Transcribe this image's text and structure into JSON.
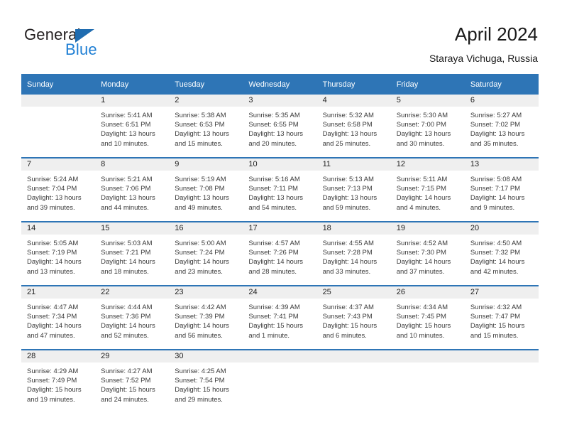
{
  "brand": {
    "name_part1": "General",
    "name_part2": "Blue",
    "triangle_color": "#1f6cb0",
    "blue_text_color": "#1f7fd4"
  },
  "header": {
    "title": "April 2024",
    "subtitle": "Staraya Vichuga, Russia"
  },
  "theme": {
    "header_blue": "#2e75b6",
    "daynum_band": "#efefef",
    "text": "#3a3a3a"
  },
  "weekday_headers": [
    "Sunday",
    "Monday",
    "Tuesday",
    "Wednesday",
    "Thursday",
    "Friday",
    "Saturday"
  ],
  "weeks": [
    [
      {
        "day": "",
        "sunrise": "",
        "sunset": "",
        "daylight_line1": "",
        "daylight_line2": "",
        "empty": true
      },
      {
        "day": "1",
        "sunrise": "Sunrise: 5:41 AM",
        "sunset": "Sunset: 6:51 PM",
        "daylight_line1": "Daylight: 13 hours",
        "daylight_line2": "and 10 minutes."
      },
      {
        "day": "2",
        "sunrise": "Sunrise: 5:38 AM",
        "sunset": "Sunset: 6:53 PM",
        "daylight_line1": "Daylight: 13 hours",
        "daylight_line2": "and 15 minutes."
      },
      {
        "day": "3",
        "sunrise": "Sunrise: 5:35 AM",
        "sunset": "Sunset: 6:55 PM",
        "daylight_line1": "Daylight: 13 hours",
        "daylight_line2": "and 20 minutes."
      },
      {
        "day": "4",
        "sunrise": "Sunrise: 5:32 AM",
        "sunset": "Sunset: 6:58 PM",
        "daylight_line1": "Daylight: 13 hours",
        "daylight_line2": "and 25 minutes."
      },
      {
        "day": "5",
        "sunrise": "Sunrise: 5:30 AM",
        "sunset": "Sunset: 7:00 PM",
        "daylight_line1": "Daylight: 13 hours",
        "daylight_line2": "and 30 minutes."
      },
      {
        "day": "6",
        "sunrise": "Sunrise: 5:27 AM",
        "sunset": "Sunset: 7:02 PM",
        "daylight_line1": "Daylight: 13 hours",
        "daylight_line2": "and 35 minutes."
      }
    ],
    [
      {
        "day": "7",
        "sunrise": "Sunrise: 5:24 AM",
        "sunset": "Sunset: 7:04 PM",
        "daylight_line1": "Daylight: 13 hours",
        "daylight_line2": "and 39 minutes."
      },
      {
        "day": "8",
        "sunrise": "Sunrise: 5:21 AM",
        "sunset": "Sunset: 7:06 PM",
        "daylight_line1": "Daylight: 13 hours",
        "daylight_line2": "and 44 minutes."
      },
      {
        "day": "9",
        "sunrise": "Sunrise: 5:19 AM",
        "sunset": "Sunset: 7:08 PM",
        "daylight_line1": "Daylight: 13 hours",
        "daylight_line2": "and 49 minutes."
      },
      {
        "day": "10",
        "sunrise": "Sunrise: 5:16 AM",
        "sunset": "Sunset: 7:11 PM",
        "daylight_line1": "Daylight: 13 hours",
        "daylight_line2": "and 54 minutes."
      },
      {
        "day": "11",
        "sunrise": "Sunrise: 5:13 AM",
        "sunset": "Sunset: 7:13 PM",
        "daylight_line1": "Daylight: 13 hours",
        "daylight_line2": "and 59 minutes."
      },
      {
        "day": "12",
        "sunrise": "Sunrise: 5:11 AM",
        "sunset": "Sunset: 7:15 PM",
        "daylight_line1": "Daylight: 14 hours",
        "daylight_line2": "and 4 minutes."
      },
      {
        "day": "13",
        "sunrise": "Sunrise: 5:08 AM",
        "sunset": "Sunset: 7:17 PM",
        "daylight_line1": "Daylight: 14 hours",
        "daylight_line2": "and 9 minutes."
      }
    ],
    [
      {
        "day": "14",
        "sunrise": "Sunrise: 5:05 AM",
        "sunset": "Sunset: 7:19 PM",
        "daylight_line1": "Daylight: 14 hours",
        "daylight_line2": "and 13 minutes."
      },
      {
        "day": "15",
        "sunrise": "Sunrise: 5:03 AM",
        "sunset": "Sunset: 7:21 PM",
        "daylight_line1": "Daylight: 14 hours",
        "daylight_line2": "and 18 minutes."
      },
      {
        "day": "16",
        "sunrise": "Sunrise: 5:00 AM",
        "sunset": "Sunset: 7:24 PM",
        "daylight_line1": "Daylight: 14 hours",
        "daylight_line2": "and 23 minutes."
      },
      {
        "day": "17",
        "sunrise": "Sunrise: 4:57 AM",
        "sunset": "Sunset: 7:26 PM",
        "daylight_line1": "Daylight: 14 hours",
        "daylight_line2": "and 28 minutes."
      },
      {
        "day": "18",
        "sunrise": "Sunrise: 4:55 AM",
        "sunset": "Sunset: 7:28 PM",
        "daylight_line1": "Daylight: 14 hours",
        "daylight_line2": "and 33 minutes."
      },
      {
        "day": "19",
        "sunrise": "Sunrise: 4:52 AM",
        "sunset": "Sunset: 7:30 PM",
        "daylight_line1": "Daylight: 14 hours",
        "daylight_line2": "and 37 minutes."
      },
      {
        "day": "20",
        "sunrise": "Sunrise: 4:50 AM",
        "sunset": "Sunset: 7:32 PM",
        "daylight_line1": "Daylight: 14 hours",
        "daylight_line2": "and 42 minutes."
      }
    ],
    [
      {
        "day": "21",
        "sunrise": "Sunrise: 4:47 AM",
        "sunset": "Sunset: 7:34 PM",
        "daylight_line1": "Daylight: 14 hours",
        "daylight_line2": "and 47 minutes."
      },
      {
        "day": "22",
        "sunrise": "Sunrise: 4:44 AM",
        "sunset": "Sunset: 7:36 PM",
        "daylight_line1": "Daylight: 14 hours",
        "daylight_line2": "and 52 minutes."
      },
      {
        "day": "23",
        "sunrise": "Sunrise: 4:42 AM",
        "sunset": "Sunset: 7:39 PM",
        "daylight_line1": "Daylight: 14 hours",
        "daylight_line2": "and 56 minutes."
      },
      {
        "day": "24",
        "sunrise": "Sunrise: 4:39 AM",
        "sunset": "Sunset: 7:41 PM",
        "daylight_line1": "Daylight: 15 hours",
        "daylight_line2": "and 1 minute."
      },
      {
        "day": "25",
        "sunrise": "Sunrise: 4:37 AM",
        "sunset": "Sunset: 7:43 PM",
        "daylight_line1": "Daylight: 15 hours",
        "daylight_line2": "and 6 minutes."
      },
      {
        "day": "26",
        "sunrise": "Sunrise: 4:34 AM",
        "sunset": "Sunset: 7:45 PM",
        "daylight_line1": "Daylight: 15 hours",
        "daylight_line2": "and 10 minutes."
      },
      {
        "day": "27",
        "sunrise": "Sunrise: 4:32 AM",
        "sunset": "Sunset: 7:47 PM",
        "daylight_line1": "Daylight: 15 hours",
        "daylight_line2": "and 15 minutes."
      }
    ],
    [
      {
        "day": "28",
        "sunrise": "Sunrise: 4:29 AM",
        "sunset": "Sunset: 7:49 PM",
        "daylight_line1": "Daylight: 15 hours",
        "daylight_line2": "and 19 minutes."
      },
      {
        "day": "29",
        "sunrise": "Sunrise: 4:27 AM",
        "sunset": "Sunset: 7:52 PM",
        "daylight_line1": "Daylight: 15 hours",
        "daylight_line2": "and 24 minutes."
      },
      {
        "day": "30",
        "sunrise": "Sunrise: 4:25 AM",
        "sunset": "Sunset: 7:54 PM",
        "daylight_line1": "Daylight: 15 hours",
        "daylight_line2": "and 29 minutes."
      },
      {
        "day": "",
        "sunrise": "",
        "sunset": "",
        "daylight_line1": "",
        "daylight_line2": "",
        "empty": true
      },
      {
        "day": "",
        "sunrise": "",
        "sunset": "",
        "daylight_line1": "",
        "daylight_line2": "",
        "empty": true
      },
      {
        "day": "",
        "sunrise": "",
        "sunset": "",
        "daylight_line1": "",
        "daylight_line2": "",
        "empty": true
      },
      {
        "day": "",
        "sunrise": "",
        "sunset": "",
        "daylight_line1": "",
        "daylight_line2": "",
        "empty": true
      }
    ]
  ]
}
